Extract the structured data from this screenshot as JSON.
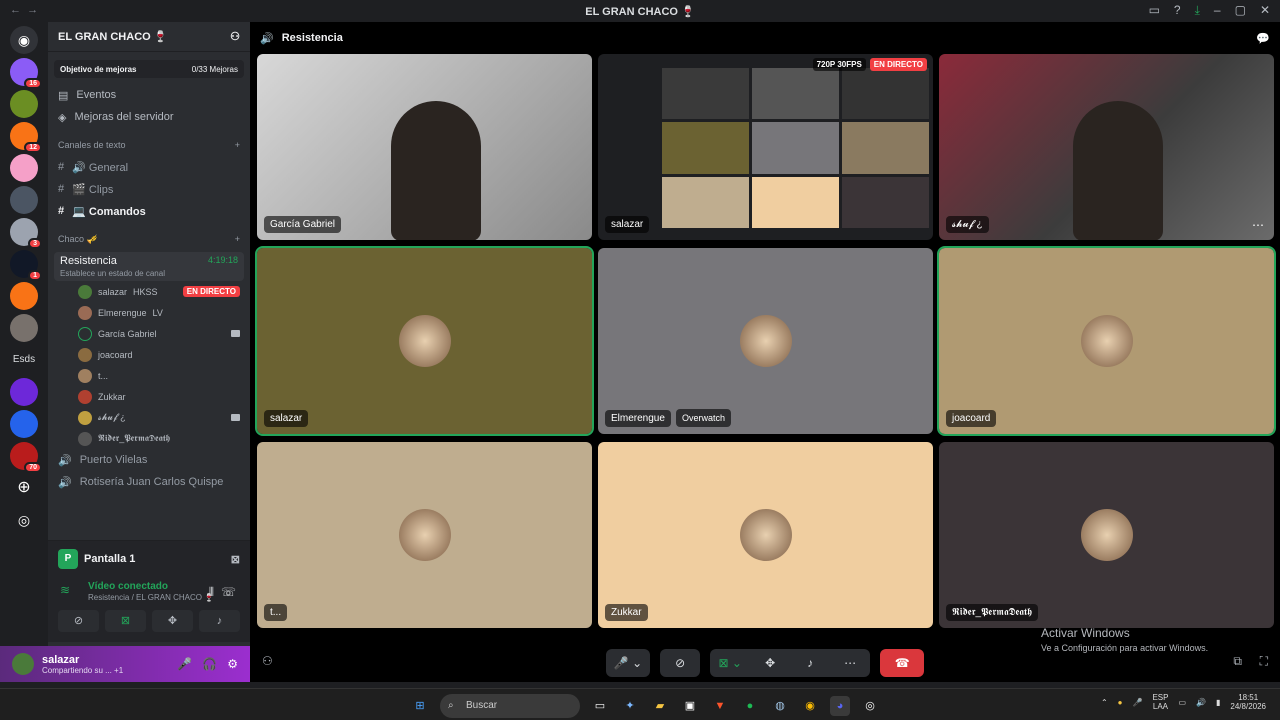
{
  "window": {
    "title": "EL GRAN CHACO 🍷"
  },
  "servers": [
    {
      "color": "#8b5cf6",
      "badge": "16"
    },
    {
      "color": "#6b8e23",
      "badge": ""
    },
    {
      "color": "#f97316",
      "badge": "12"
    },
    {
      "color": "#f5a0c8",
      "badge": ""
    },
    {
      "color": "#4b5563",
      "badge": ""
    },
    {
      "color": "#9ca3af",
      "badge": "3"
    },
    {
      "color": "#111827",
      "badge": "1"
    },
    {
      "color": "#f97316",
      "badge": ""
    },
    {
      "color": "#78716c",
      "badge": ""
    }
  ],
  "server_text": "Esds",
  "servers2": [
    {
      "color": "#6d28d9",
      "badge": ""
    },
    {
      "color": "#2563eb",
      "badge": ""
    },
    {
      "color": "#b91c1c",
      "badge": "70"
    }
  ],
  "sidebar": {
    "guild_name": "EL GRAN CHACO 🍷",
    "boost_label": "Objetivo de mejoras",
    "boost_count": "0/33 Mejoras",
    "events": "Eventos",
    "server_boosts": "Mejoras del servidor",
    "text_category": "Canales de texto",
    "text_channels": [
      "🔊 General",
      "🎬 Clips",
      "💻 Comandos"
    ],
    "voice_category": "Chaco 🎺",
    "voice_channel": "Resistencia",
    "voice_time": "4:19:18",
    "voice_status": "Establece un estado de canal",
    "voice_users": [
      {
        "name": "salazar",
        "extra": "HKSS",
        "live": "EN DIRECTO",
        "color": "#4a7a3a",
        "cam": false
      },
      {
        "name": "Elmerengue",
        "extra": "LV",
        "live": "",
        "color": "#9a6b55",
        "cam": false
      },
      {
        "name": "García Gabriel",
        "extra": "",
        "live": "",
        "color": "#2b2d31",
        "cam": true
      },
      {
        "name": "joacoard",
        "extra": "",
        "live": "",
        "color": "#8a6b40",
        "cam": false
      },
      {
        "name": "t...",
        "extra": "",
        "live": "",
        "color": "#a08060",
        "cam": false
      },
      {
        "name": "Zukkar",
        "extra": "",
        "live": "",
        "color": "#b04030",
        "cam": false
      },
      {
        "name": "𝓼𝓱𝓾𝓯 ¿",
        "extra": "",
        "live": "",
        "color": "#c0a040",
        "cam": true
      },
      {
        "name": "𝕽𝖎𝖉𝖊𝖗_𝕻𝖊𝖗𝖒𝖆𝕯𝖊𝖆𝖙𝖍",
        "extra": "",
        "live": "",
        "color": "#555",
        "cam": false
      }
    ],
    "other_voice": [
      "Puerto Vilelas",
      "Rotisería Juan Carlos Quispe"
    ]
  },
  "rtc": {
    "pantalla": "Pantalla 1",
    "connected": "Vídeo conectado",
    "location": "Resistencia / EL GRAN CHACO 🍷"
  },
  "user": {
    "name": "salazar",
    "status": "Compartiendo su ...",
    "extra": "+1"
  },
  "main": {
    "channel": "Resistencia",
    "tiles": [
      {
        "name": "García Gabriel",
        "kind": "video"
      },
      {
        "name": "salazar",
        "kind": "stream",
        "res": "720P 30FPS",
        "live": "EN DIRECTO"
      },
      {
        "name": "𝓼𝓱𝓾𝓯 ¿",
        "kind": "video"
      },
      {
        "name": "salazar",
        "kind": "avatar",
        "bg": "#6b6232",
        "active": true
      },
      {
        "name": "Elmerengue",
        "kind": "avatar",
        "bg": "#77767a",
        "game": "Overwatch"
      },
      {
        "name": "joacoard",
        "kind": "avatar",
        "bg": "#b09a72",
        "active": true
      },
      {
        "name": "t...",
        "kind": "avatar",
        "bg": "#bfad8f"
      },
      {
        "name": "Zukkar",
        "kind": "avatar",
        "bg": "#f0ceA0"
      },
      {
        "name": "𝕽𝖎𝖉𝖊𝖗_𝕻𝖊𝖗𝖒𝖆𝕯𝖊𝖆𝖙𝖍",
        "kind": "avatar",
        "bg": "#3b3437"
      }
    ]
  },
  "watermark": {
    "line1": "Activar Windows",
    "line2": "Ve a Configuración para activar Windows."
  },
  "taskbar": {
    "search": "Buscar",
    "lang": "ESP",
    "lang2": "LAA",
    "time": "18:51",
    "date": "24/8/2026"
  }
}
